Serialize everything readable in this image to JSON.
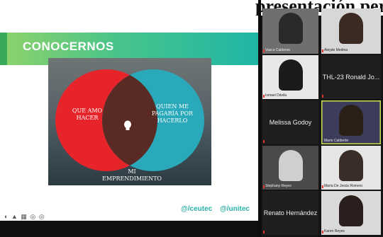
{
  "banner": {
    "title": "presentación personal"
  },
  "slide": {
    "heading": "CONOCERNOS",
    "venn_left": "QUE AMO HACER",
    "venn_right": "QUIEN ME PAGARÍA POR HACERLO",
    "venn_center": "MI EMPRENDIMIENTO",
    "logos": [
      "@/ceutec",
      "@/unitec"
    ],
    "footer_controls": "◐ ▲ ▦ ◎ ◎"
  },
  "participants": [
    {
      "name": "Vasco Calderon",
      "has_video": true
    },
    {
      "name": "Aleydo Medina",
      "has_video": true
    },
    {
      "name": "Ismael Dávila",
      "has_video": true
    },
    {
      "name": "THL-23 Ronald Jo...",
      "has_video": false
    },
    {
      "name": "Melissa Godoy",
      "has_video": false
    },
    {
      "name": "Mario Calderón",
      "has_video": true,
      "active": true
    },
    {
      "name": "Stephany Reyes",
      "has_video": true
    },
    {
      "name": "María De Jesús Romero",
      "has_video": true
    },
    {
      "name": "Renato Hernández",
      "has_video": false
    },
    {
      "name": "Karen Reyes",
      "has_video": true
    }
  ],
  "colors": {
    "venn_red": "#e8242b",
    "venn_teal": "#29a9b9",
    "header_green": "#49c48a",
    "active_border": "#c8e04a"
  }
}
